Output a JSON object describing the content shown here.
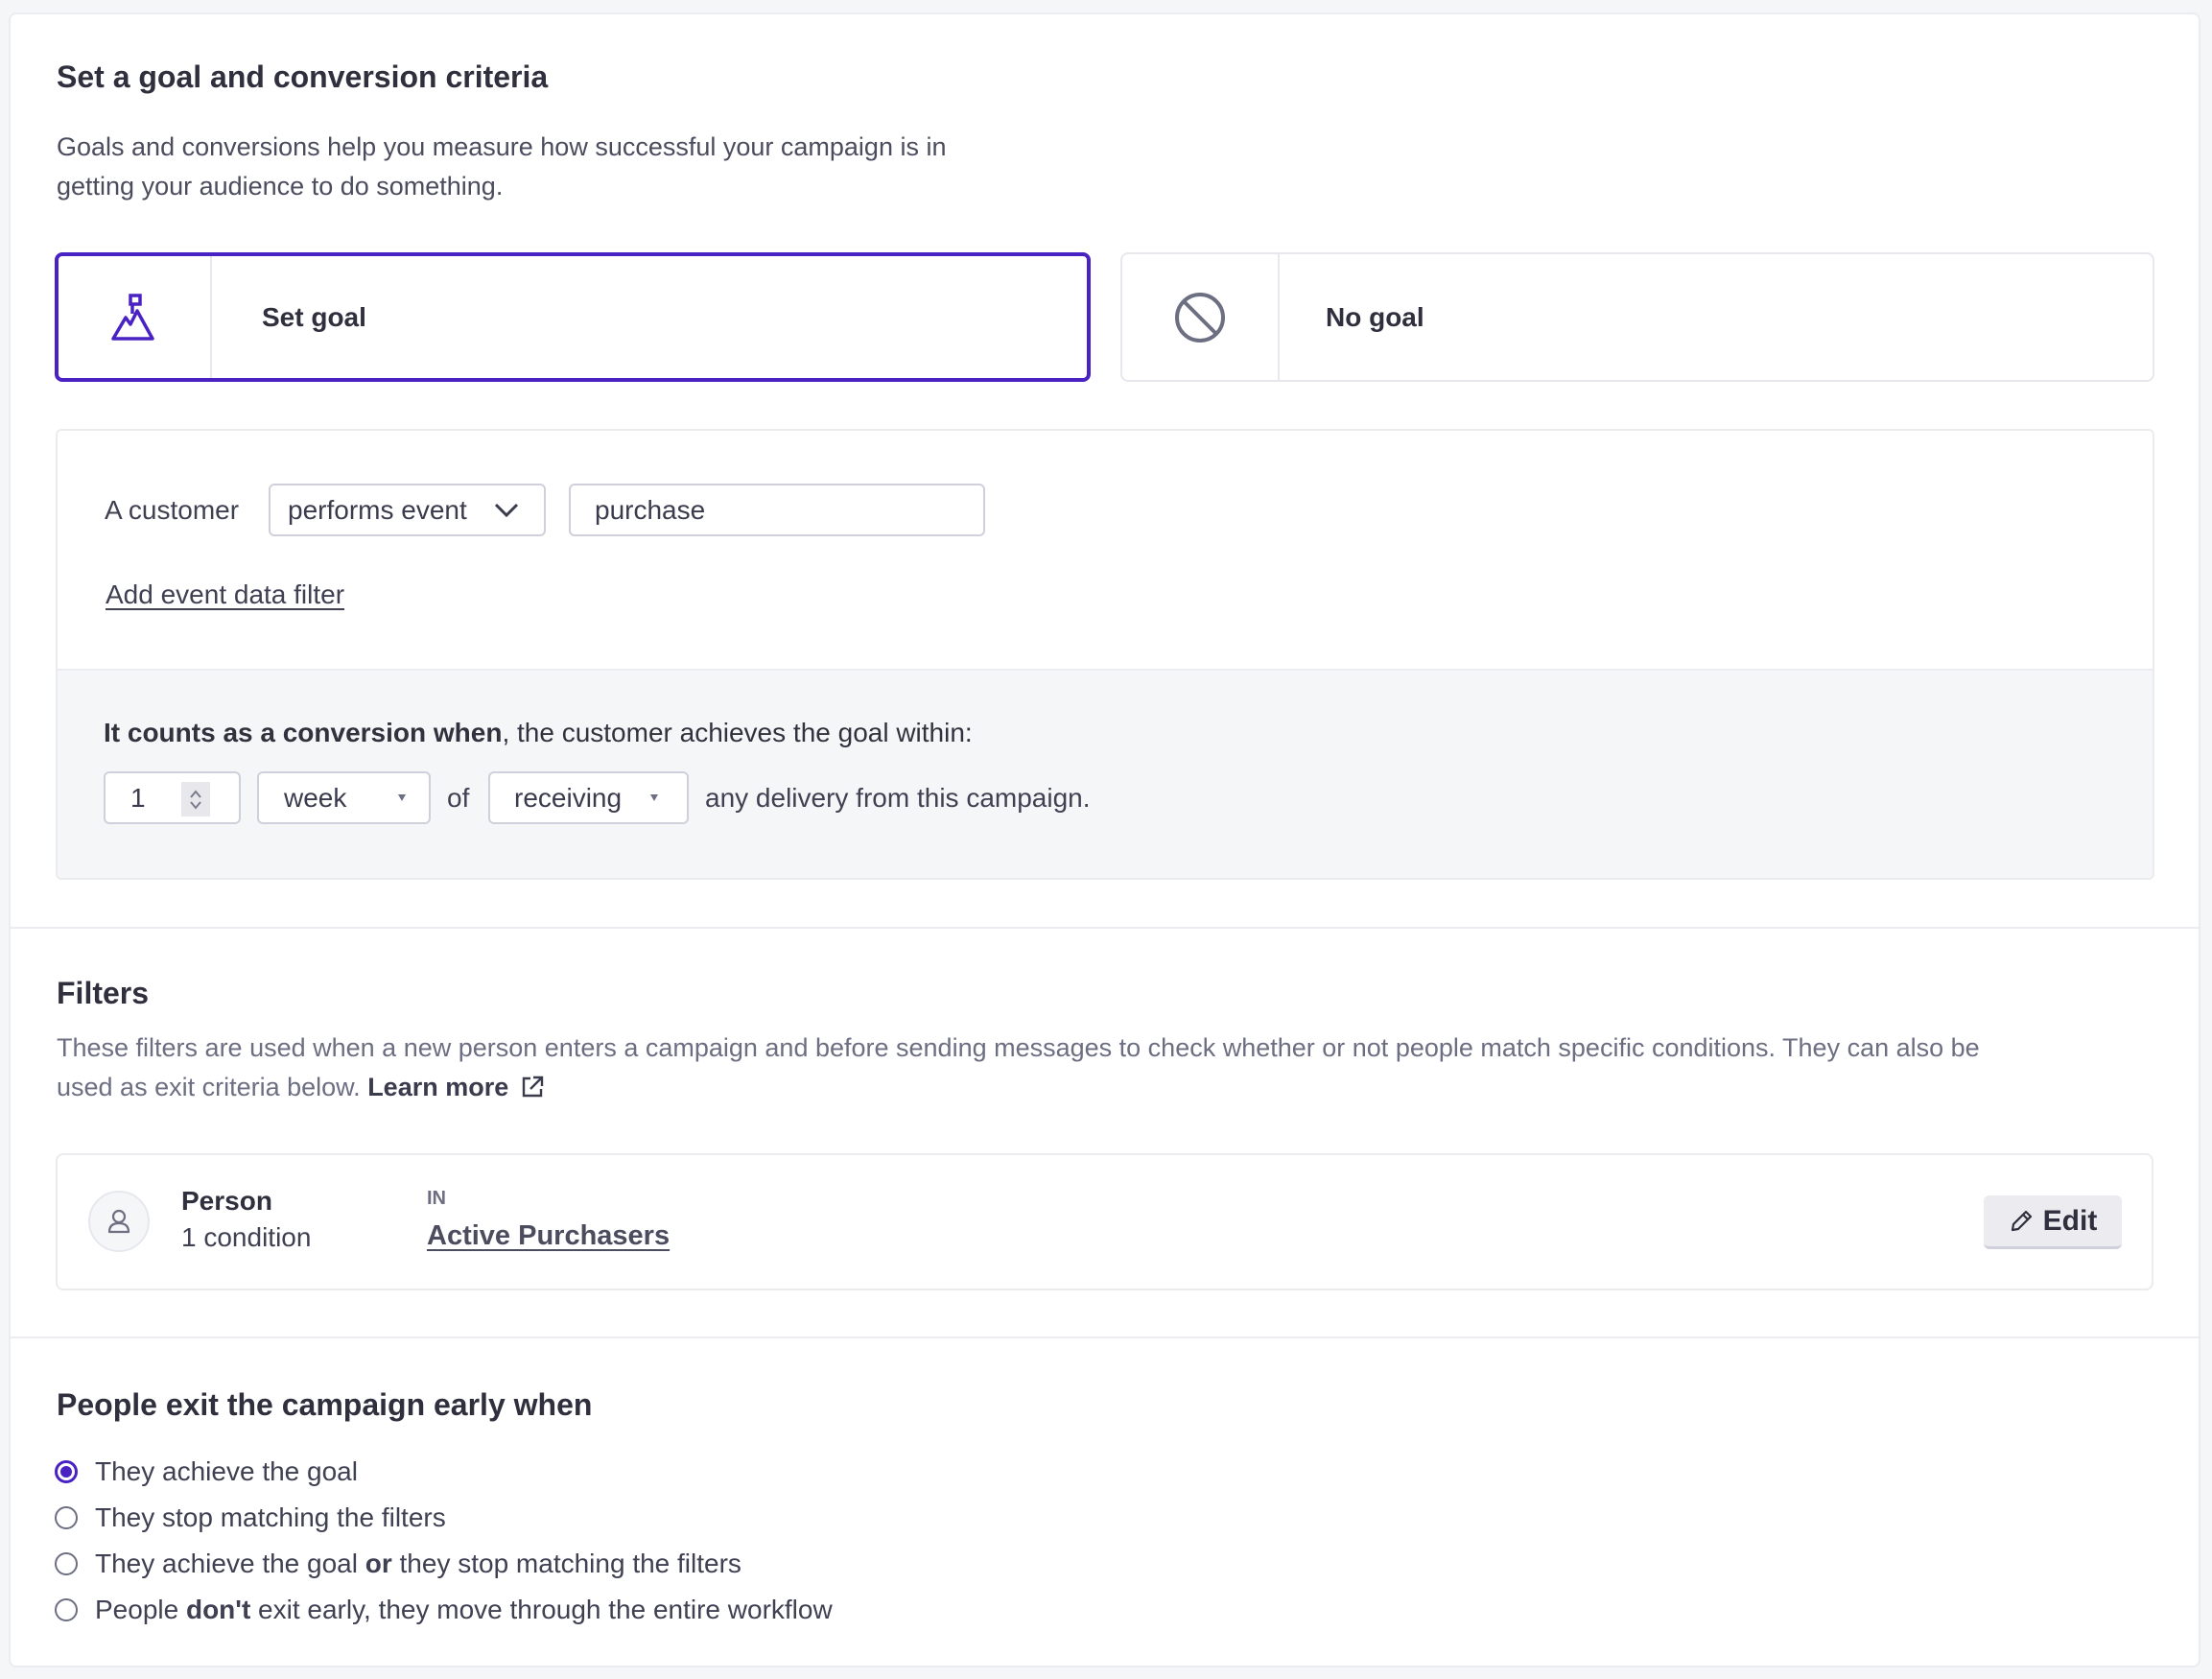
{
  "goal_section": {
    "title": "Set a goal and conversion criteria",
    "description_line1": "Goals and conversions help you measure how successful your campaign is in",
    "description_line2": "getting your audience to do something.",
    "options": [
      {
        "label": "Set goal",
        "icon": "mountain-flag-icon",
        "selected": true
      },
      {
        "label": "No goal",
        "icon": "prohibited-icon",
        "selected": false
      }
    ],
    "criteria": {
      "prefix": "A customer",
      "condition_select": "performs event",
      "event_input_value": "purchase",
      "add_filter_link": "Add event data filter"
    },
    "conversion": {
      "bold_text": "It counts as a conversion when",
      "rest_text": ", the customer achieves the goal within:",
      "number_value": "1",
      "unit_select": "week",
      "of_text": "of",
      "action_select": "receiving",
      "suffix": "any delivery from this campaign."
    }
  },
  "filters_section": {
    "title": "Filters",
    "description_line1": "These filters are used when a new person enters a campaign and before sending messages to check whether or not people match specific conditions. They can also be",
    "description_line2": "used as exit criteria below.",
    "learn_more": "Learn more",
    "filter": {
      "type": "Person",
      "conditions": "1 condition",
      "operator": "IN",
      "segment": "Active Purchasers",
      "edit_label": "Edit"
    }
  },
  "exit_section": {
    "title": "People exit the campaign early when",
    "options": [
      {
        "pre": "They achieve the goal",
        "bold": "",
        "post": "",
        "checked": true
      },
      {
        "pre": "They stop matching the filters",
        "bold": "",
        "post": "",
        "checked": false
      },
      {
        "pre": "They achieve the goal ",
        "bold": "or",
        "post": " they stop matching the filters",
        "checked": false
      },
      {
        "pre": "People ",
        "bold": "don't",
        "post": " exit early, they move through the entire workflow",
        "checked": false
      }
    ]
  },
  "colors": {
    "accent": "#4a22c4",
    "text": "#32323f",
    "muted": "#6c6e82",
    "background": "#f5f6f8"
  }
}
